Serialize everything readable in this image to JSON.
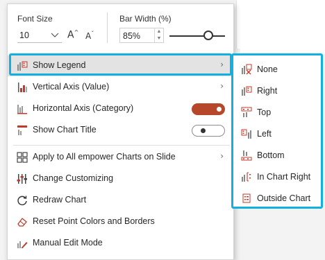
{
  "ribbon": {
    "font_size_label": "Font Size",
    "font_size_value": "10",
    "grow_font": "A",
    "shrink_font": "A",
    "bar_width_label": "Bar Width (%)",
    "bar_width_value": "85%",
    "bar_width_slider_fraction": 0.7
  },
  "menu": {
    "items": [
      {
        "label": "Show Legend",
        "has_submenu": true,
        "highlighted": true
      },
      {
        "label": "Vertical Axis (Value)",
        "has_submenu": true
      },
      {
        "label": "Horizontal Axis (Category)",
        "toggle": "on"
      },
      {
        "label": "Show Chart Title",
        "toggle": "off"
      },
      {
        "label": "Apply to All empower Charts on Slide",
        "has_submenu": true
      },
      {
        "label": "Change Customizing"
      },
      {
        "label": "Redraw Chart"
      },
      {
        "label": "Reset Point Colors and Borders"
      },
      {
        "label": "Manual Edit Mode"
      }
    ],
    "submenu_arrow": "›"
  },
  "legend_submenu": {
    "items": [
      {
        "label": "None"
      },
      {
        "label": "Right"
      },
      {
        "label": "Top"
      },
      {
        "label": "Left"
      },
      {
        "label": "Bottom"
      },
      {
        "label": "In Chart Right"
      },
      {
        "label": "Outside Chart"
      }
    ]
  },
  "colors": {
    "highlight_border": "#11b0e0",
    "toggle_on": "#b7472a",
    "icon_red": "#c0392b"
  }
}
